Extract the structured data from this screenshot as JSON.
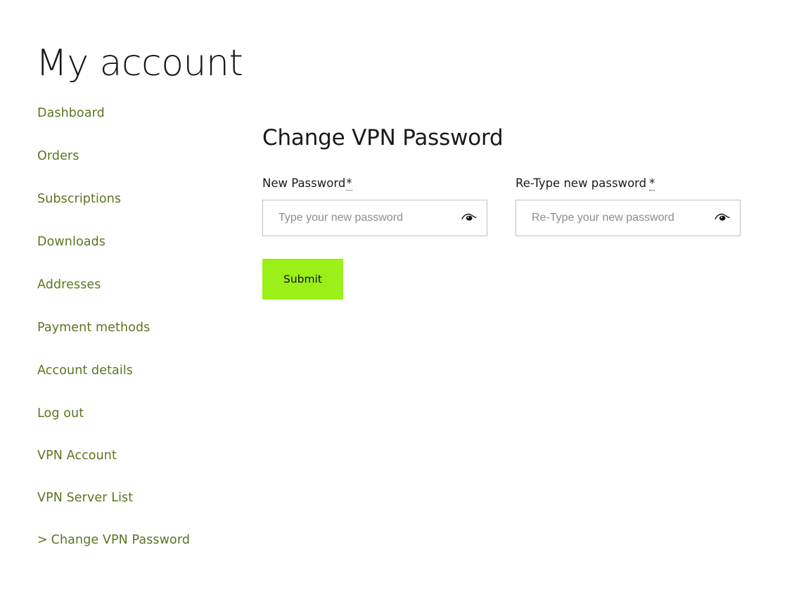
{
  "page": {
    "title": "My account"
  },
  "sidebar": {
    "items": [
      {
        "label": "Dashboard",
        "active": false,
        "prefix": ""
      },
      {
        "label": "Orders",
        "active": false,
        "prefix": ""
      },
      {
        "label": "Subscriptions",
        "active": false,
        "prefix": ""
      },
      {
        "label": "Downloads",
        "active": false,
        "prefix": ""
      },
      {
        "label": "Addresses",
        "active": false,
        "prefix": ""
      },
      {
        "label": "Payment methods",
        "active": false,
        "prefix": ""
      },
      {
        "label": "Account details",
        "active": false,
        "prefix": ""
      },
      {
        "label": "Log out",
        "active": false,
        "prefix": ""
      },
      {
        "label": "VPN Account",
        "active": false,
        "prefix": ""
      },
      {
        "label": "VPN Server List",
        "active": false,
        "prefix": ""
      },
      {
        "label": "Change VPN Password",
        "active": true,
        "prefix": ">"
      }
    ],
    "link_color": "#5b7520"
  },
  "main": {
    "heading": "Change VPN Password",
    "form": {
      "new_password": {
        "label": "New Password",
        "required_mark": "*",
        "placeholder": "Type your new password",
        "value": "",
        "toggle_icon": "eye-icon"
      },
      "retype_password": {
        "label": "Re-Type new password",
        "required_mark": "*",
        "placeholder": "Re-Type your new password",
        "value": "",
        "toggle_icon": "eye-icon"
      },
      "submit_label": "Submit",
      "submit_color": "#9bf017"
    }
  }
}
